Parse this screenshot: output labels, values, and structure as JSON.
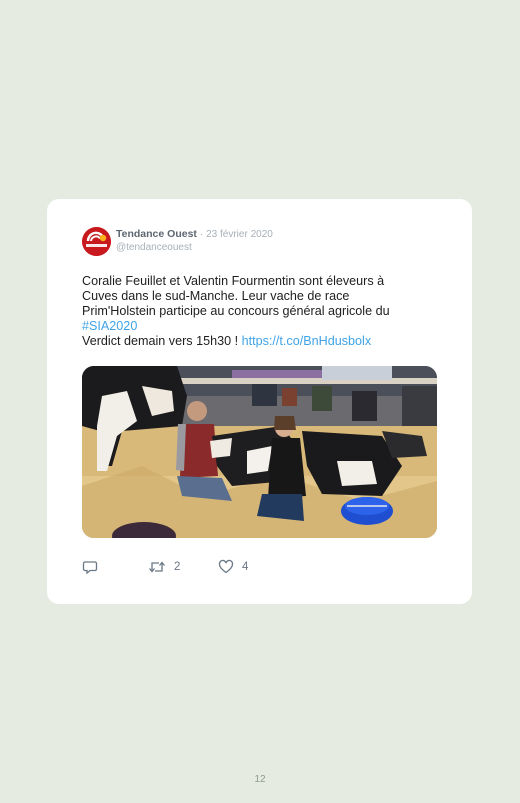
{
  "tweet": {
    "author": "Tendance Ouest",
    "separator": "·",
    "date": "23 février 2020",
    "handle": "@tendanceouest",
    "avatar_text": "TENDANCE",
    "text_lines": [
      "Coralie Feuillet et Valentin Fourmentin sont éleveurs à",
      "Cuves dans le sud-Manche. Leur vache de race",
      "Prim'Holstein participe au concours général agricole du"
    ],
    "hashtag": "#SIA2020",
    "last_line_prefix": "Verdict demain vers 15h30 ! ",
    "link": "https://t.co/BnHdusbolx",
    "actions": {
      "reply_icon": "reply-icon",
      "retweet_icon": "retweet-icon",
      "retweet_count": "2",
      "like_icon": "heart-icon",
      "like_count": "4"
    }
  },
  "page_number": "12",
  "colors": {
    "background": "#e5ebe0",
    "card": "#ffffff",
    "link": "#3fa3e6",
    "brand": "#c8191e"
  }
}
